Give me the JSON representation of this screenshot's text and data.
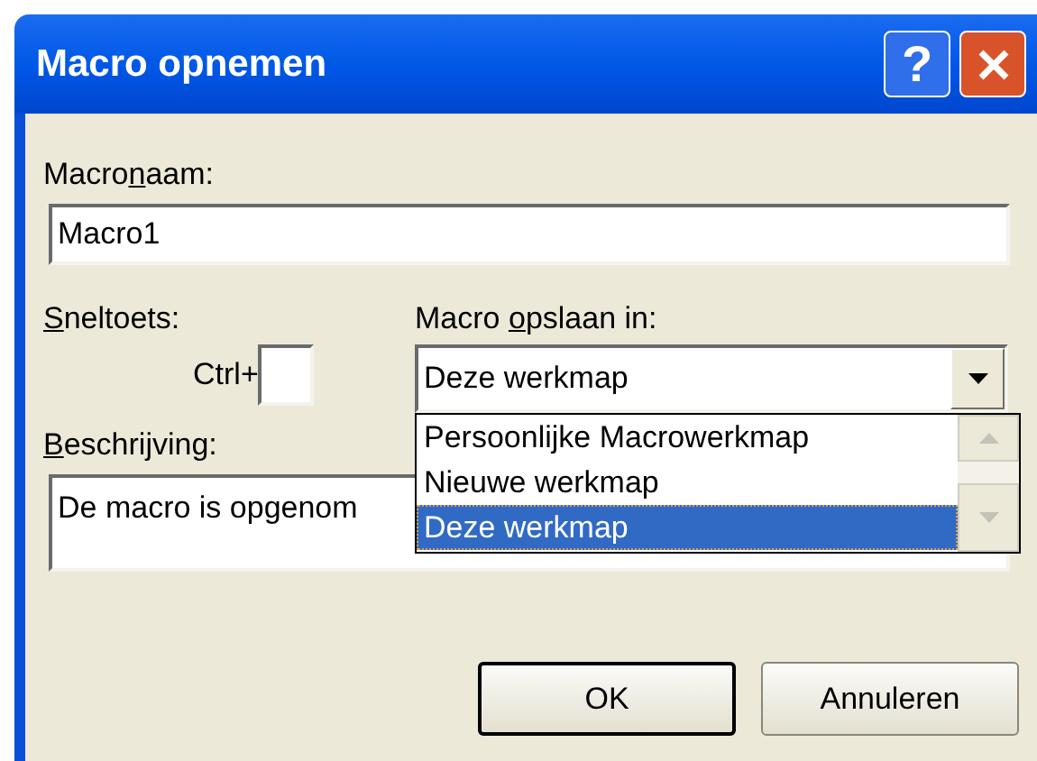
{
  "window": {
    "title": "Macro opnemen"
  },
  "title_buttons": [
    {
      "kind": "help",
      "label": "?"
    },
    {
      "kind": "close"
    }
  ],
  "macro_name": {
    "label": {
      "before": "Macro",
      "key": "n",
      "after": "aam:"
    },
    "value": "Macro1"
  },
  "shortcut": {
    "label": {
      "key": "S",
      "after": "neltoets:"
    },
    "prefix": "Ctrl+"
  },
  "store_in": {
    "label": {
      "before": "Macro ",
      "key": "o",
      "after": "pslaan in:"
    },
    "value": "Deze werkmap",
    "expanded": true,
    "options": [
      {
        "label": "Persoonlijke Macrowerkmap",
        "selected": false
      },
      {
        "label": "Nieuwe werkmap",
        "selected": false
      },
      {
        "label": "Deze werkmap",
        "selected": true
      }
    ]
  },
  "description": {
    "label": {
      "key": "B",
      "after": "eschrijving:"
    },
    "value": "De macro is opgenom"
  },
  "buttons": [
    {
      "label": "OK",
      "default": true
    },
    {
      "label": "Annuleren",
      "default": false
    }
  ]
}
